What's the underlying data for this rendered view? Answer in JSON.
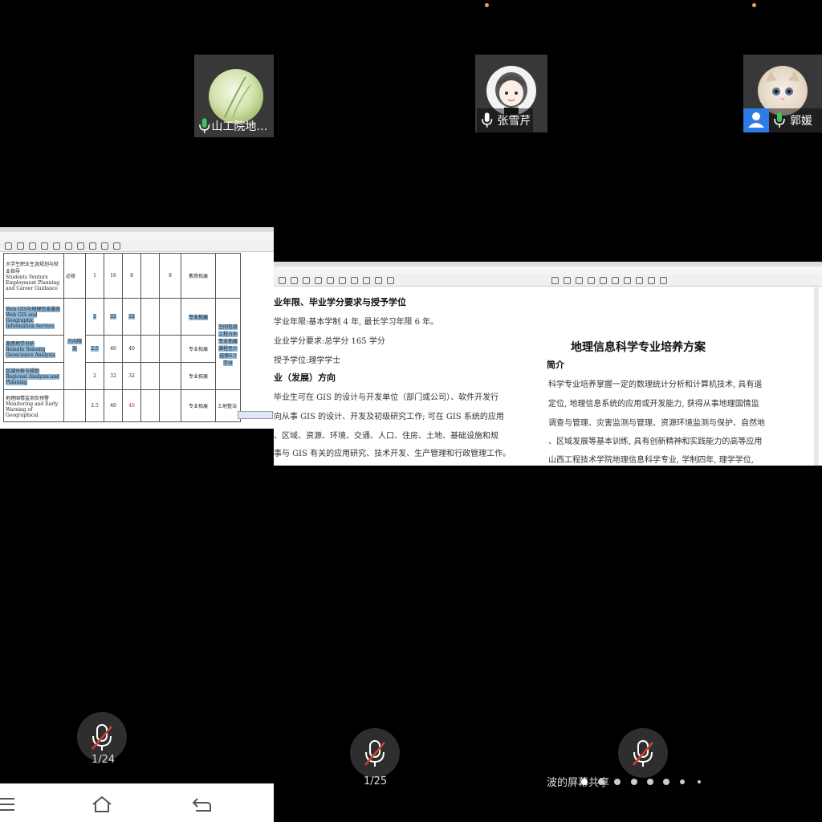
{
  "participants": [
    {
      "name": "山工院地…",
      "avatar": "wheat-photo"
    },
    {
      "name": "张雪芹",
      "avatar": "cartoon-girl"
    },
    {
      "name": "郭媛",
      "avatar": "cat-photo"
    }
  ],
  "left_doc": {
    "page_indicator": "1/24",
    "table_rows": [
      {
        "name_cn": "大学生职业生涯规划与就业指导",
        "name_en": "Students Venture Employment Planning and Career Guidance",
        "type": "必修",
        "credit": "1",
        "hours": "16",
        "h1": "8",
        "h2": "",
        "h3": "8",
        "cat": "素质拓展",
        "note": ""
      },
      {
        "name_cn": "Web GIS与地理信息服务",
        "name_en": "Web GIS and Geographic Information Service",
        "type": "方向限选",
        "credit": "2",
        "hours": "32",
        "h1": "32",
        "h2": "",
        "h3": "",
        "cat": "专业拓展",
        "note": "空间信息工程方向专业拓展课程至少选修6.5学分"
      },
      {
        "name_cn": "遥感地学分析",
        "name_en": "Remote Sensing Geoscience Analysis",
        "type": "",
        "credit": "2.5",
        "hours": "40",
        "h1": "40",
        "h2": "",
        "h3": "",
        "cat": "专业拓展",
        "note": ""
      },
      {
        "name_cn": "区域分析与规划",
        "name_en": "Regional Analysis and Planning",
        "type": "",
        "credit": "2",
        "hours": "32",
        "h1": "32",
        "h2": "",
        "h3": "",
        "cat": "专业拓展",
        "note": ""
      },
      {
        "name_cn": "地理国情监测及预警",
        "name_en": "Monitoring and Early Warning of Geographical",
        "type": "",
        "credit": "2.5",
        "hours": "40",
        "h1": "40",
        "h2": "",
        "h3": "",
        "cat": "专业拓展",
        "note": "土地整治"
      }
    ]
  },
  "mid_doc": {
    "page_indicator": "1/25",
    "heading1": "业年限、毕业学分要求与授予学位",
    "line1": "学业年限:基本学制 4 年, 最长学习年限 6 年。",
    "line2": "业业学分要求:总学分 165 学分",
    "line3": "授予学位:理学学士",
    "heading2": "业（发展）方向",
    "line4": "毕业生可在 GIS 的设计与开发单位（部门或公司）、软件开发行",
    "line5": "向从事 GIS 的设计、开发及初级研究工作; 可在 GIS 系统的应用",
    "line6": "、区域、资源、环境、交通、人口、住房、土地、基础设施和规",
    "line7": "事与 GIS 有关的应用研究、技术开发、生产管理和行政管理工作。"
  },
  "right_doc": {
    "title": "地理信息科学专业培养方案",
    "heading": "简介",
    "line1": "科学专业培养掌握一定的数理统计分析和计算机技术, 具有遥",
    "line2": "定位, 地理信息系统的应用或开发能力, 获得从事地理国情监",
    "line3": "调查与管理、灾害监测与管理、资源环境监测与保护、自然地",
    "line4": "、区域发展等基本训练, 具有创新精神和实践能力的高等应用",
    "line5": "山西工程技术学院地理信息科学专业, 学制四年, 理学学位,",
    "share_label": "波的屏幕共享"
  },
  "colors": {
    "accent": "#2f7be5",
    "mic_green": "#3fc45a",
    "muted_red": "#d04030",
    "highlight": "#8fb8d8"
  },
  "icons": {
    "menu": "hamburger-icon",
    "home": "home-icon",
    "back": "back-icon"
  }
}
